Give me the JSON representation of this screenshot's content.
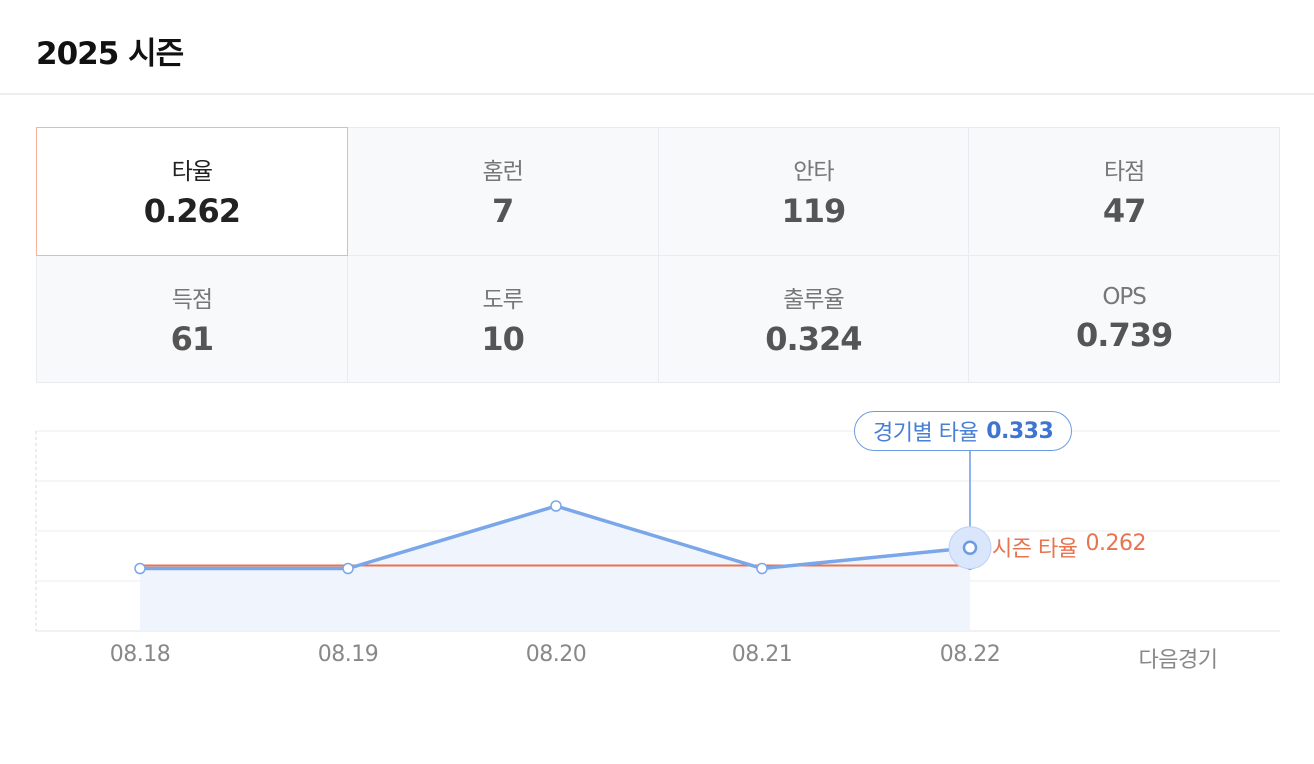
{
  "header": {
    "title": "2025 시즌"
  },
  "stats": [
    {
      "label": "타율",
      "value": "0.262",
      "selected": true
    },
    {
      "label": "홈런",
      "value": "7"
    },
    {
      "label": "안타",
      "value": "119"
    },
    {
      "label": "타점",
      "value": "47"
    },
    {
      "label": "득점",
      "value": "61"
    },
    {
      "label": "도루",
      "value": "10"
    },
    {
      "label": "출루율",
      "value": "0.324"
    },
    {
      "label": "OPS",
      "value": "0.739"
    }
  ],
  "chart_data": {
    "type": "line",
    "categories": [
      "08.18",
      "08.19",
      "08.20",
      "08.21",
      "08.22",
      "다음경기"
    ],
    "series": [
      {
        "name": "경기별 타율",
        "values": [
          0.25,
          0.25,
          0.5,
          0.25,
          0.333
        ],
        "color": "#7aa6ea"
      },
      {
        "name": "시즌 타율",
        "values": [
          0.262,
          0.262,
          0.262,
          0.262,
          0.262
        ],
        "color": "#e8734f"
      }
    ],
    "ylim": [
      0,
      0.8
    ],
    "grid": true,
    "tooltip": {
      "label": "경기별 타율",
      "value": "0.333"
    },
    "season_label": {
      "label": "시즌 타율",
      "value": "0.262"
    }
  },
  "colors": {
    "accent_blue": "#7aa6ea",
    "accent_orange": "#e8734f",
    "selected_border": "#f5b49e"
  }
}
